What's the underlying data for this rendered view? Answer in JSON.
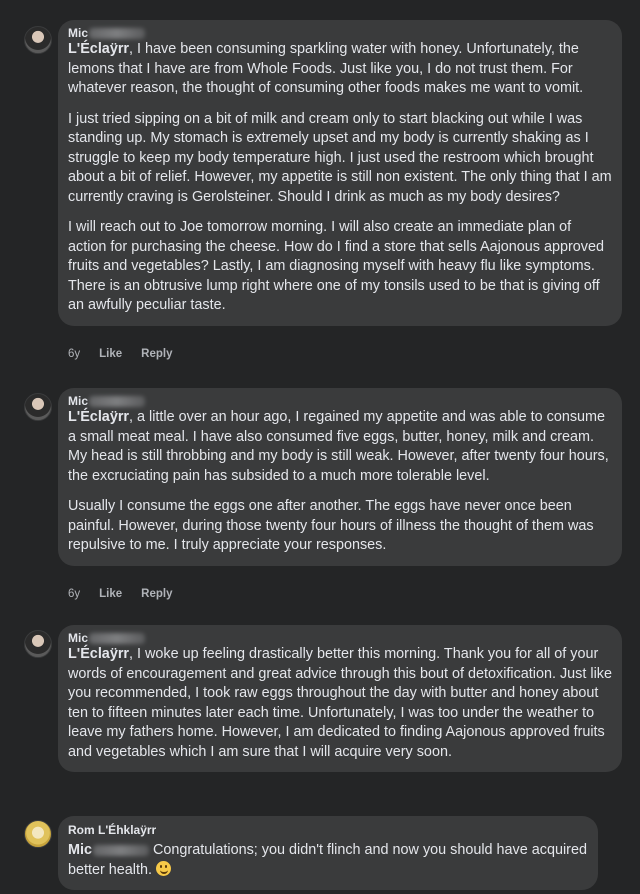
{
  "comments": [
    {
      "author": "Mic",
      "mention": "L'Éclaÿrr",
      "paragraphs": [
        ", I have been consuming sparkling water with honey. Unfortunately, the lemons that I have are from Whole Foods. Just like you, I do not trust them. For whatever reason, the thought of consuming other foods makes me want to vomit.",
        "I just tried sipping on a bit of milk and cream only to start blacking out while I was standing up. My stomach is extremely upset and my body is currently shaking as I struggle to keep my body temperature high. I just used the restroom which brought about a bit of relief. However, my appetite is still non existent. The only thing that I am currently craving is Gerolsteiner. Should I drink as much as my body desires?",
        "I will reach out to Joe tomorrow morning. I will also create an immediate plan of action for purchasing the cheese. How do I find a store that sells Aajonous approved fruits and vegetables? Lastly, I am diagnosing myself with heavy flu like symptoms. There is an obtrusive lump right where one of my tonsils used to be that is giving off an awfully peculiar taste."
      ],
      "age": "6y",
      "like": "Like",
      "reply": "Reply"
    },
    {
      "author": "Mic",
      "mention": "L'Éclaÿrr",
      "paragraphs": [
        ", a little over an hour ago, I regained my appetite and was able to consume a small meat meal. I have also consumed five eggs, butter, honey, milk and cream. My head is still throbbing and my body is still weak. However, after twenty four hours, the excruciating pain has subsided to a much more tolerable level.",
        "Usually I consume the eggs one after another. The eggs have never once been painful. However, during those twenty four hours of illness the thought of them was repulsive to me. I truly appreciate your responses."
      ],
      "age": "6y",
      "like": "Like",
      "reply": "Reply"
    },
    {
      "author": "Mic",
      "mention": "L'Éclaÿrr",
      "paragraphs": [
        ", I woke up feeling drastically better this morning. Thank you for all of your words of encouragement and great advice through this bout of detoxification. Just like you recommended, I took raw eggs throughout the day with butter and honey about ten to fifteen minutes later each time. Unfortunately, I was too under the weather to leave my fathers home. However, I am dedicated to finding Aajonous approved fruits and vegetables which I am sure that I will acquire very soon."
      ]
    },
    {
      "author": "Rom L'Éhklaÿrr",
      "mention": "Mic",
      "paragraphs": [
        " Congratulations; you didn't flinch and now you should have acquired better health."
      ],
      "emoji": "smiling-face"
    }
  ]
}
